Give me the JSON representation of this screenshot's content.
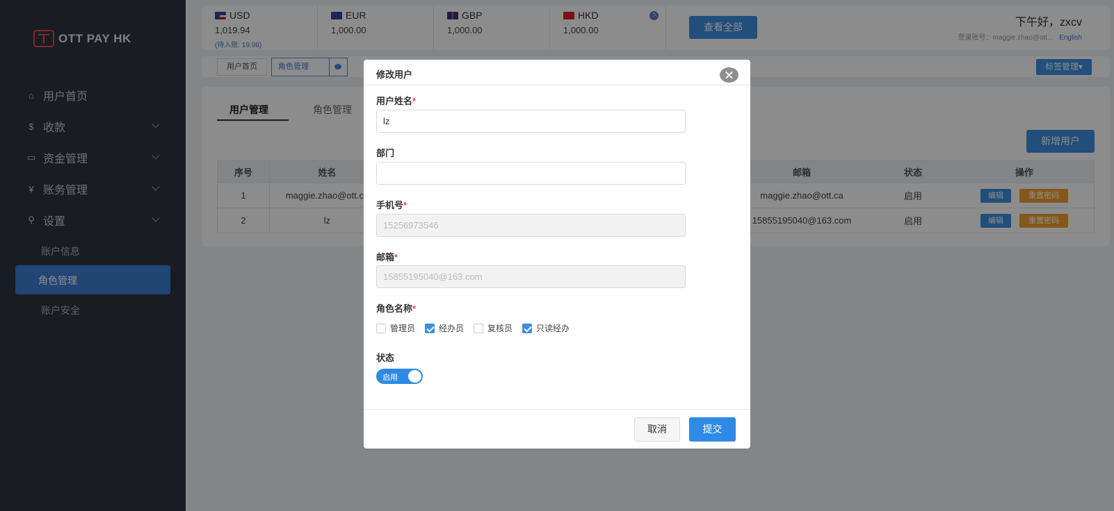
{
  "sidebar": {
    "logo": "OTT PAY HK",
    "items": [
      {
        "label": "用户首页",
        "icon": "home-icon"
      },
      {
        "label": "收款",
        "icon": "dollar-icon"
      },
      {
        "label": "资金管理",
        "icon": "card-icon"
      },
      {
        "label": "账务管理",
        "icon": "yen-icon"
      },
      {
        "label": "设置",
        "icon": "search-icon"
      }
    ],
    "sub_items": [
      "账户信息",
      "角色管理",
      "账户安全"
    ],
    "active_sub": "角色管理"
  },
  "header": {
    "currencies": [
      {
        "code": "USD",
        "amount": "1,019.94",
        "pending": "(待入账: 19.98)"
      },
      {
        "code": "EUR",
        "amount": "1,000.00"
      },
      {
        "code": "GBP",
        "amount": "1,000.00"
      },
      {
        "code": "HKD",
        "amount": "1,000.00"
      }
    ],
    "help": "?",
    "view_all": "查看全部",
    "greeting": "下午好，zxcv",
    "account": "登录账号：maggie.zhao@ott...",
    "language": "English"
  },
  "tags": {
    "home": "用户首页",
    "role": "角色管理",
    "tag_manage": "标签管理▾"
  },
  "content": {
    "tabs": [
      "用户管理",
      "角色管理"
    ],
    "add_user": "新增用户",
    "columns": {
      "idx": "序号",
      "name": "姓名",
      "email": "邮箱",
      "status": "状态",
      "ops": "操作"
    },
    "rows": [
      {
        "idx": "1",
        "name": "maggie.zhao@ott.ca",
        "email": "maggie.zhao@ott.ca",
        "status": "启用",
        "edit": "编辑",
        "reset": "重置密码"
      },
      {
        "idx": "2",
        "name": "lz",
        "email": "15855195040@163.com",
        "status": "启用",
        "edit": "编辑",
        "reset": "重置密码"
      }
    ]
  },
  "modal": {
    "title": "修改用户",
    "fields": {
      "username_label": "用户姓名",
      "username_value": "lz",
      "dept_label": "部门",
      "dept_value": "",
      "phone_label": "手机号",
      "phone_value": "15256973546",
      "email_label": "邮箱",
      "email_value": "15855195040@163.com",
      "role_label": "角色名称",
      "status_label": "状态"
    },
    "required_mark": "*",
    "roles": [
      {
        "label": "管理员",
        "checked": false
      },
      {
        "label": "经办员",
        "checked": true
      },
      {
        "label": "复核员",
        "checked": false
      },
      {
        "label": "只读经办",
        "checked": true
      }
    ],
    "status_toggle": "启用",
    "cancel": "取消",
    "submit": "提交"
  }
}
